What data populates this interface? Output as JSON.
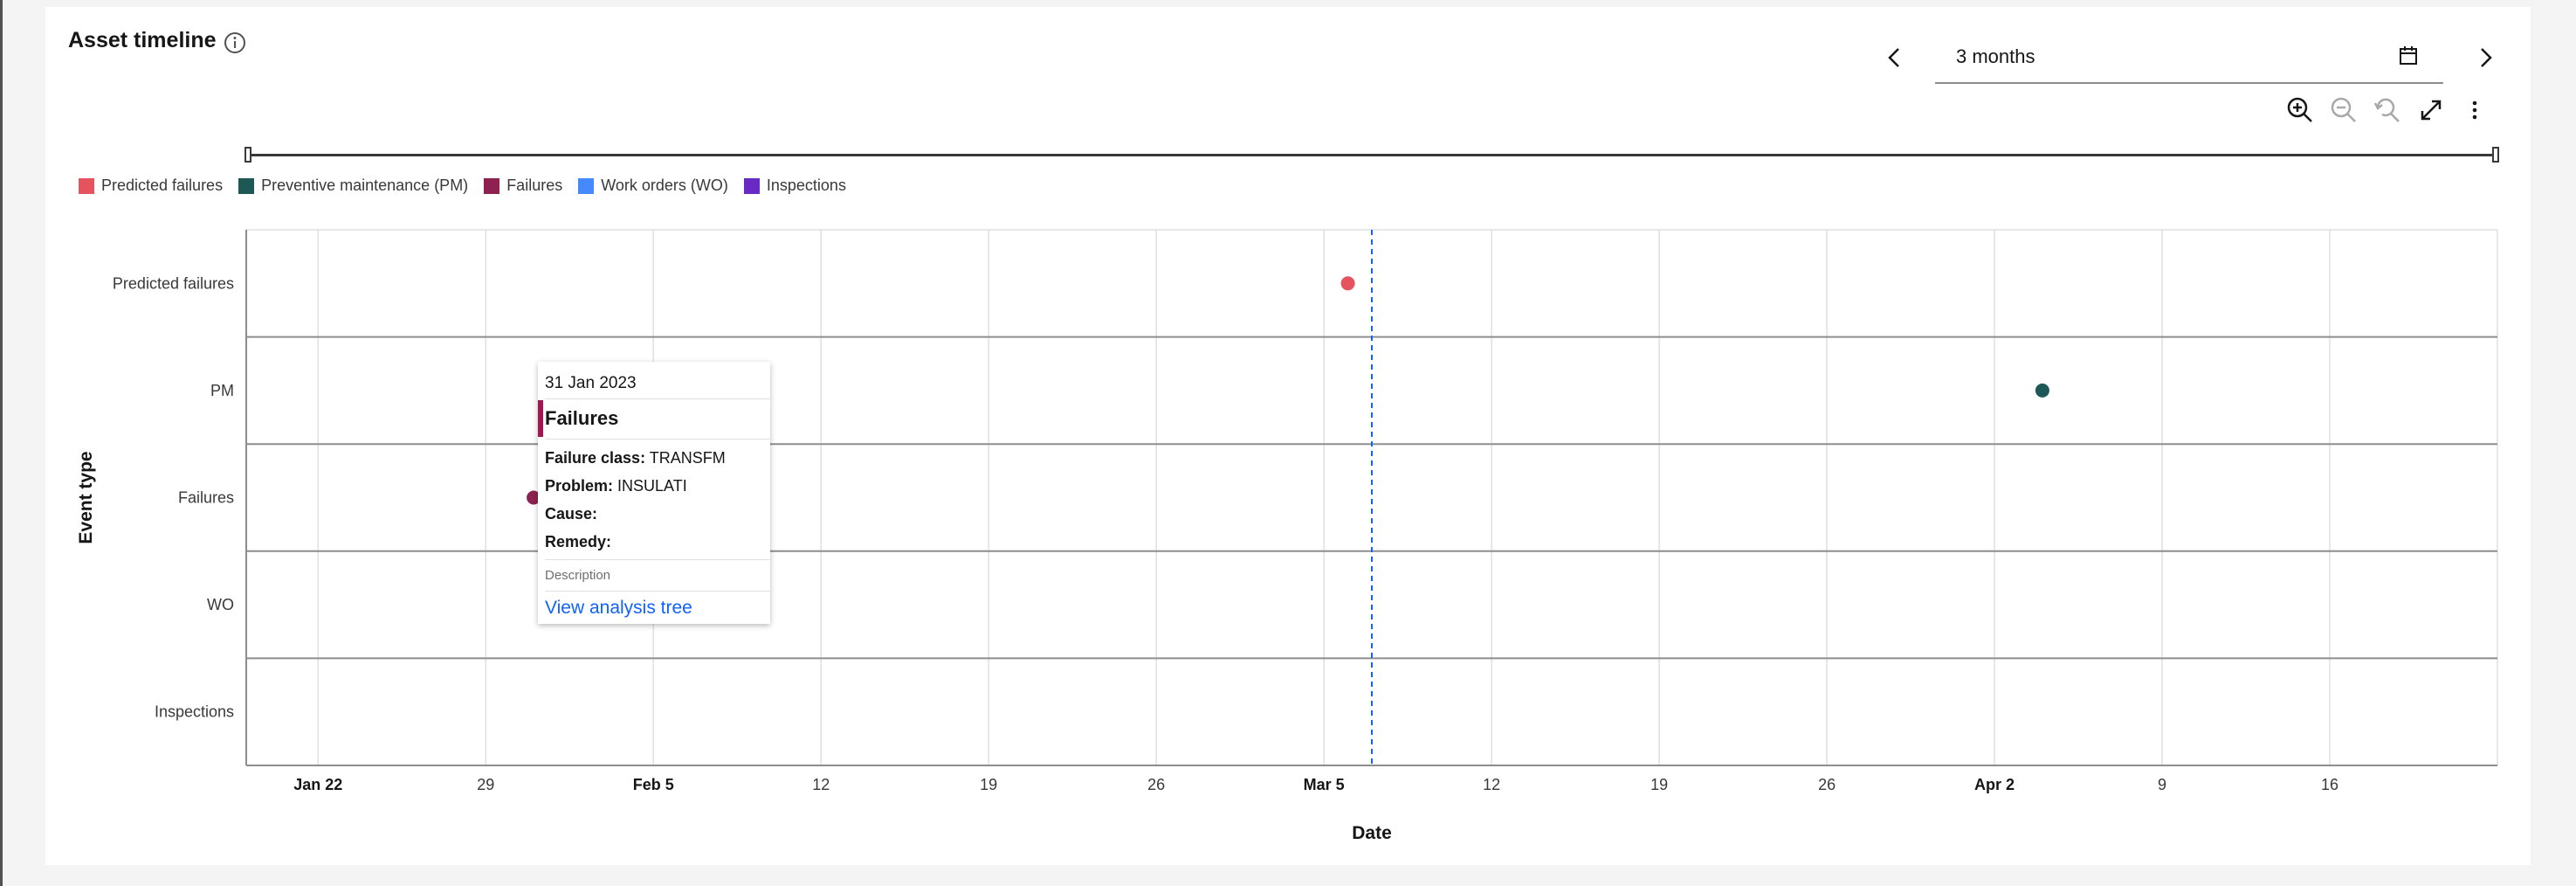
{
  "header": {
    "title": "Asset timeline",
    "range_value": "3 months"
  },
  "icons": {
    "info": "info-icon",
    "prev": "chevron-left-icon",
    "next": "chevron-right-icon",
    "calendar": "calendar-icon",
    "zoom_in": "zoom-in-icon",
    "zoom_out": "zoom-out-icon",
    "reset_zoom": "reset-zoom-icon",
    "maximize": "maximize-icon",
    "overflow": "overflow-menu-icon"
  },
  "legend": [
    {
      "label": "Predicted failures",
      "color": "#e5535f"
    },
    {
      "label": "Preventive maintenance (PM)",
      "color": "#1d5856"
    },
    {
      "label": "Failures",
      "color": "#8d2250"
    },
    {
      "label": "Work orders (WO)",
      "color": "#4589ff"
    },
    {
      "label": "Inspections",
      "color": "#6929c4"
    }
  ],
  "chart_data": {
    "type": "scatter",
    "xlabel": "Date",
    "ylabel": "Event type",
    "categories": [
      "Predicted failures",
      "PM",
      "Failures",
      "WO",
      "Inspections"
    ],
    "xlim": [
      "2023-01-19",
      "2023-04-23"
    ],
    "x_ticks": [
      {
        "date": "2023-01-22",
        "label": "Jan 22",
        "bold": true
      },
      {
        "date": "2023-01-29",
        "label": "29",
        "bold": false
      },
      {
        "date": "2023-02-05",
        "label": "Feb 5",
        "bold": true
      },
      {
        "date": "2023-02-12",
        "label": "12",
        "bold": false
      },
      {
        "date": "2023-02-19",
        "label": "19",
        "bold": false
      },
      {
        "date": "2023-02-26",
        "label": "26",
        "bold": false
      },
      {
        "date": "2023-03-05",
        "label": "Mar 5",
        "bold": true
      },
      {
        "date": "2023-03-12",
        "label": "12",
        "bold": false
      },
      {
        "date": "2023-03-19",
        "label": "19",
        "bold": false
      },
      {
        "date": "2023-03-26",
        "label": "26",
        "bold": false
      },
      {
        "date": "2023-04-02",
        "label": "Apr 2",
        "bold": true
      },
      {
        "date": "2023-04-09",
        "label": "9",
        "bold": false
      },
      {
        "date": "2023-04-16",
        "label": "16",
        "bold": false
      }
    ],
    "points": [
      {
        "category": "Predicted failures",
        "date": "2023-03-06",
        "color": "#e5535f"
      },
      {
        "category": "PM",
        "date": "2023-04-04",
        "color": "#1d5856"
      },
      {
        "category": "Failures",
        "date": "2023-01-31",
        "color": "#8d2250"
      }
    ],
    "today_marker": "2023-03-07",
    "grid": true
  },
  "tooltip": {
    "date": "31 Jan 2023",
    "heading": "Failures",
    "failure_class_label": "Failure class:",
    "failure_class_value": "TRANSFM",
    "problem_label": "Problem:",
    "problem_value": "INSULATI",
    "cause_label": "Cause:",
    "cause_value": "",
    "remedy_label": "Remedy:",
    "remedy_value": "",
    "description_label": "Description",
    "link": "View analysis tree",
    "accent": "#9f1853"
  }
}
